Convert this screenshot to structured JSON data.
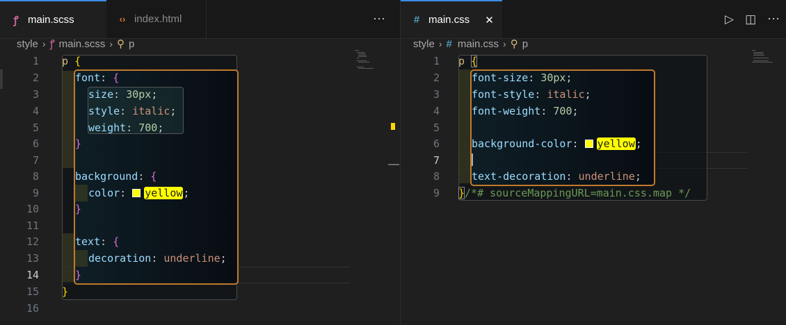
{
  "left_pane": {
    "tabs": [
      {
        "icon": "sass-icon",
        "glyph": "ꝭ",
        "label": "main.scss",
        "active": true,
        "color": "#cd6799"
      },
      {
        "icon": "html-icon",
        "glyph": "‹›",
        "label": "index.html",
        "active": false,
        "color": "#e37933"
      }
    ],
    "more_actions_glyph": "⋯",
    "breadcrumb": {
      "folder": "style",
      "file_icon": "sass-icon",
      "file_glyph": "ꝭ",
      "file": "main.scss",
      "symbol_icon": "selector-icon",
      "symbol_glyph": "⚲",
      "symbol": "p"
    },
    "line_numbers": [
      "1",
      "2",
      "3",
      "4",
      "5",
      "6",
      "7",
      "8",
      "9",
      "10",
      "11",
      "12",
      "13",
      "14",
      "15",
      "16"
    ],
    "current_line": 14
  },
  "right_pane": {
    "tab": {
      "icon": "css-icon",
      "glyph": "#",
      "label": "main.css",
      "close_glyph": "✕",
      "color": "#519aba"
    },
    "actions": {
      "run_glyph": "▷",
      "split_glyph": "◫",
      "more_glyph": "⋯"
    },
    "breadcrumb": {
      "folder": "style",
      "file_icon": "css-icon",
      "file_glyph": "#",
      "file": "main.css",
      "symbol_icon": "selector-icon",
      "symbol_glyph": "⚲",
      "symbol": "p"
    },
    "line_numbers": [
      "1",
      "2",
      "3",
      "4",
      "5",
      "6",
      "7",
      "8",
      "9"
    ],
    "current_line": 7
  },
  "colors": {
    "accent": "#3c8ce7",
    "scope_border": "#c17a2c",
    "highlight": "#ffff00"
  }
}
